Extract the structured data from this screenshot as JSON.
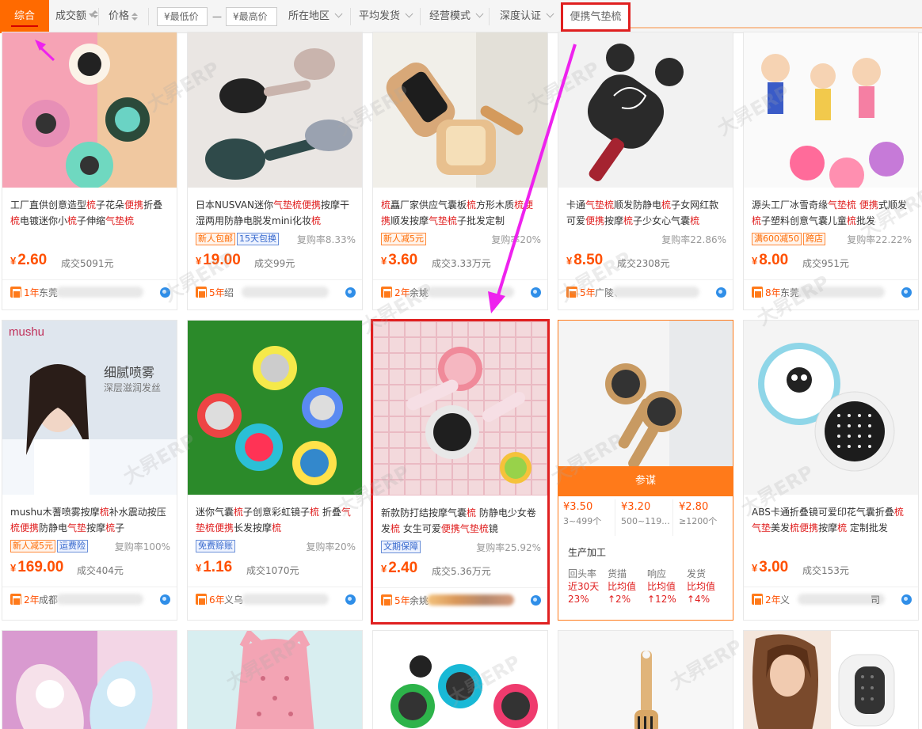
{
  "filter_bar": {
    "sort_general": "综合",
    "sort_volume": "成交额",
    "sort_price": "价格",
    "min_price_placeholder": "¥最低价",
    "dash": "—",
    "max_price_placeholder": "¥最高价",
    "location": "所在地区",
    "avg_ship": "平均发货",
    "biz_mode": "经营模式",
    "deep_cert": "深度认证",
    "search_tag": "便携气垫梳"
  },
  "products": [
    {
      "title_parts": [
        "工厂直供创意造型",
        "梳",
        "子花朵",
        "便携",
        "折叠",
        "梳",
        "电镀迷你小",
        "梳",
        "子伸缩",
        "气垫梳"
      ],
      "tags": [],
      "rate": "",
      "price": "2.60",
      "sold": "成交5091元",
      "years": "1年",
      "shop": "东莞",
      "colors": {
        "a": "#f6a3b5",
        "b": "#f0c8a0"
      }
    },
    {
      "title_parts": [
        "日本NUSVAN迷你",
        "气垫梳",
        "便携",
        "按摩干湿两用防静电脱发mini化妆",
        "梳"
      ],
      "tags": [
        {
          "t": "新人包邮",
          "c": "o"
        },
        {
          "t": "15天包换",
          "c": "b"
        }
      ],
      "rate": "复购率8.33%",
      "price": "19.00",
      "sold": "成交99元",
      "years": "5年",
      "shop": "绍",
      "colors": {
        "a": "#eae6e3",
        "b": "#c9b4ad"
      }
    },
    {
      "title_parts": [
        "梳",
        "矗厂家供应气囊板",
        "梳",
        "方形木质",
        "梳",
        "",
        "便携",
        "顺发按摩",
        "气垫梳",
        "子批发定制"
      ],
      "tags": [
        {
          "t": "新人减5元",
          "c": "o"
        }
      ],
      "rate": "复购率20%",
      "price": "3.60",
      "sold": "成交3.33万元",
      "years": "2年",
      "shop": "余姚",
      "colors": {
        "a": "#f1efe9",
        "b": "#d8a878"
      }
    },
    {
      "title_parts": [
        "卡通",
        "气垫梳",
        "顺发防静电",
        "梳",
        "子女网红款可爱",
        "便携",
        "按摩",
        "梳",
        "子少女心气囊",
        "梳"
      ],
      "tags": [],
      "rate": "复购率22.86%",
      "price": "8.50",
      "sold": "成交2308元",
      "years": "5年",
      "shop": "广陵、",
      "colors": {
        "a": "#f2f2f2",
        "b": "#2a2a2a"
      }
    },
    {
      "title_parts": [
        "源头工厂冰雪奇缘",
        "气垫梳",
        " ",
        "便携",
        "式顺发",
        "梳",
        "子塑料创意气囊儿童",
        "梳",
        "批发"
      ],
      "tags": [
        {
          "t": "满600减50",
          "c": "o"
        },
        {
          "t": "跨店",
          "c": "o"
        }
      ],
      "rate": "复购率22.22%",
      "price": "8.00",
      "sold": "成交951元",
      "years": "8年",
      "shop": "东莞",
      "colors": {
        "a": "#fafafa",
        "b": "#ff6b9a"
      }
    },
    {
      "title_parts": [
        "mushu木蓍喷雾按摩",
        "梳",
        "补水震动按压",
        "梳",
        "便携",
        "防静电",
        "气垫",
        "按摩",
        "梳",
        "子"
      ],
      "tags": [
        {
          "t": "新人减5元",
          "c": "o"
        },
        {
          "t": "运费险",
          "c": "b"
        }
      ],
      "rate": "复购率100%",
      "price": "169.00",
      "sold": "成交404元",
      "years": "2年",
      "shop": "成都",
      "brand": "mushu",
      "ad_line1": "细腻喷雾",
      "ad_line2": "深层滋润发丝",
      "colors": {
        "a": "#dfe6ee",
        "b": "#ffffff"
      }
    },
    {
      "title_parts": [
        "迷你气囊",
        "梳",
        "子创意彩虹镜子",
        "梳",
        " 折叠",
        "气垫",
        "梳",
        "便携",
        "长发按摩",
        "梳"
      ],
      "tags": [
        {
          "t": "免费赊账",
          "c": "b"
        }
      ],
      "rate": "复购率20%",
      "price": "1.16",
      "sold": "成交1070元",
      "years": "6年",
      "shop": "义乌",
      "colors": {
        "a": "#2b8a2a",
        "b": "#f5e94a"
      }
    },
    {
      "title_parts": [
        "新款防打结按摩气囊",
        "梳",
        " 防静电少女卷发",
        "梳",
        " 女生可爱",
        "便携",
        "气垫梳",
        "镜"
      ],
      "tags": [
        {
          "t": "文期保障",
          "c": "b"
        }
      ],
      "rate": "复购率25.92%",
      "price": "2.40",
      "sold": "成交5.36万元",
      "years": "5年",
      "shop": "余姚",
      "colors": {
        "a": "#f3d9dc",
        "b": "#f08a9a"
      }
    },
    {
      "ad": true,
      "ad_label": "参谋",
      "tiers": [
        {
          "p": "¥3.50",
          "q": "3~499个"
        },
        {
          "p": "¥3.20",
          "q": "500~119..."
        },
        {
          "p": "¥2.80",
          "q": "≥1200个"
        }
      ],
      "prod_label": "生产加工",
      "stats": [
        {
          "h": "回头率",
          "v1": "近30天",
          "v2": "23%"
        },
        {
          "h": "货描",
          "v1": "比均值",
          "v2": "↑2%"
        },
        {
          "h": "响应",
          "v1": "比均值",
          "v2": "↑12%"
        },
        {
          "h": "发货",
          "v1": "比均值",
          "v2": "↑4%"
        }
      ],
      "colors": {
        "a": "#f4f4f4",
        "b": "#c89a62"
      }
    },
    {
      "title_parts": [
        "ABS卡通折叠镜可爱印花气囊折叠",
        "梳",
        "",
        "气垫",
        "美发",
        "梳",
        "便携",
        "按摩",
        "梳",
        " 定制批发"
      ],
      "tags": [],
      "rate": "",
      "price": "3.00",
      "sold": "成交153元",
      "years": "2年",
      "shop": "义",
      "shop_tail": "司",
      "colors": {
        "a": "#f4f4f4",
        "b": "#8fd6e8"
      }
    }
  ],
  "watermark": "大昇ERP",
  "currency": "¥",
  "colors": {
    "accent": "#ff6a00",
    "price": "#ff5000",
    "highlight": "#e02020",
    "annotation": "#ee22ee"
  }
}
